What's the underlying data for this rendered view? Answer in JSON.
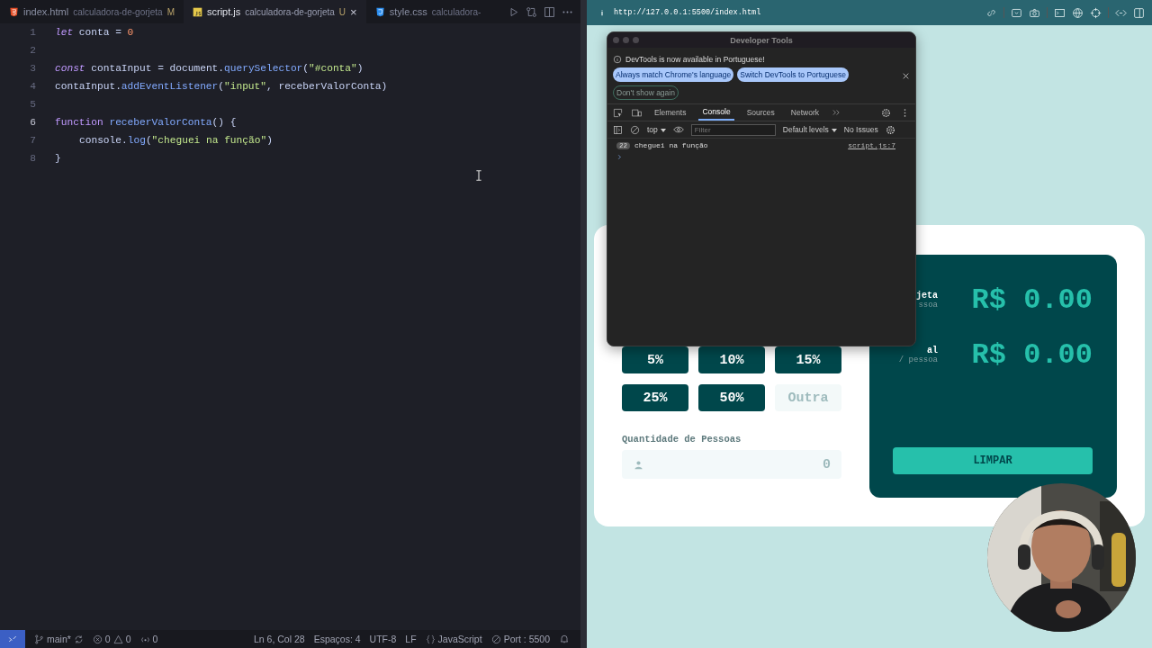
{
  "editor": {
    "tabs": [
      {
        "kind": "html",
        "name": "index.html",
        "folder": "calculadora-de-gorjeta",
        "badge": "M",
        "selected": false
      },
      {
        "kind": "js",
        "name": "script.js",
        "folder": "calculadora-de-gorjeta",
        "badge": "U",
        "selected": true,
        "close": "×"
      },
      {
        "kind": "css",
        "name": "style.css",
        "folder": "calculadora-",
        "selected": false
      }
    ],
    "lines": [
      {
        "number": "1",
        "current": false,
        "tokens": [
          {
            "kind": "storage",
            "text": "let "
          },
          {
            "kind": "var",
            "text": "conta"
          },
          {
            "kind": "plain",
            "text": " = "
          },
          {
            "kind": "num",
            "text": "0"
          }
        ]
      },
      {
        "number": "2",
        "current": false
      },
      {
        "number": "3",
        "current": false,
        "tokens": [
          {
            "kind": "storage",
            "text": "const "
          },
          {
            "kind": "var",
            "text": "contaInput"
          },
          {
            "kind": "plain",
            "text": " = "
          },
          {
            "kind": "var",
            "text": "document"
          },
          {
            "kind": "plain",
            "text": "."
          },
          {
            "kind": "method",
            "text": "querySelector"
          },
          {
            "kind": "plain",
            "text": "("
          },
          {
            "kind": "str",
            "text": "\"#conta\""
          },
          {
            "kind": "plain",
            "text": ")"
          }
        ]
      },
      {
        "number": "4",
        "current": false,
        "tokens": [
          {
            "kind": "var",
            "text": "contaInput"
          },
          {
            "kind": "plain",
            "text": "."
          },
          {
            "kind": "method",
            "text": "addEventListener"
          },
          {
            "kind": "plain",
            "text": "("
          },
          {
            "kind": "str",
            "text": "\"input\""
          },
          {
            "kind": "plain",
            "text": ", "
          },
          {
            "kind": "var",
            "text": "receberValorConta"
          },
          {
            "kind": "plain",
            "text": ")"
          }
        ]
      },
      {
        "number": "5",
        "current": false
      },
      {
        "number": "6",
        "current": true,
        "tokens": [
          {
            "kind": "keyword",
            "text": "function "
          },
          {
            "kind": "method",
            "text": "receberValorConta"
          },
          {
            "kind": "plain",
            "text": "() {"
          }
        ],
        "children": [
          {
            "number": "7",
            "current": false,
            "tokens": [
              {
                "kind": "var",
                "text": "console"
              },
              {
                "kind": "plain",
                "text": "."
              },
              {
                "kind": "method",
                "text": "log"
              },
              {
                "kind": "plain",
                "text": "("
              },
              {
                "kind": "str",
                "text": "\"cheguei na função\""
              },
              {
                "kind": "plain",
                "text": ")"
              }
            ]
          }
        ]
      },
      {
        "number": "8",
        "current": false,
        "tokens": [
          {
            "kind": "plain",
            "text": "}"
          }
        ]
      }
    ]
  },
  "status_bar": {
    "branch": "main*",
    "errors": "0",
    "warnings": "0",
    "ports": "0",
    "position": "Ln 6, Col 28",
    "indent": "Espaços: 4",
    "encoding": "UTF-8",
    "eol": "LF",
    "language": "JavaScript",
    "port": "Port : 5500"
  },
  "browser": {
    "url": "http://127.0.0.1:5500/index.html"
  },
  "calculator": {
    "tips": [
      {
        "kind": "preset",
        "label": "5%"
      },
      {
        "kind": "preset",
        "label": "10%"
      },
      {
        "kind": "preset",
        "label": "15%"
      },
      {
        "kind": "preset",
        "label": "25%"
      },
      {
        "kind": "preset",
        "label": "50%"
      },
      {
        "kind": "custom",
        "label": "Outra"
      }
    ],
    "people_label": "Quantidade de Pessoas",
    "people_value": "0",
    "results": [
      {
        "label": "jeta",
        "sub": "ssoa",
        "value": "R$ 0.00"
      },
      {
        "label": "al",
        "sub": "/ pessoa",
        "value": "R$ 0.00"
      }
    ],
    "reset": "LIMPAR"
  },
  "devtools": {
    "title": "Developer Tools",
    "notice": "DevTools is now available in Portuguese!",
    "notice_buttons": [
      "Always match Chrome's language",
      "Switch DevTools to Portuguese"
    ],
    "dismiss": "Don't show again",
    "tabs": [
      {
        "label": "Elements",
        "selected": false
      },
      {
        "label": "Console",
        "selected": true
      },
      {
        "label": "Sources",
        "selected": false
      },
      {
        "label": "Network",
        "selected": false
      }
    ],
    "context": "top",
    "filter_placeholder": "Filter",
    "levels": "Default levels",
    "issues": "No Issues",
    "messages": [
      {
        "count": "22",
        "text": "cheguei na função",
        "source": "script.js:7"
      }
    ]
  }
}
